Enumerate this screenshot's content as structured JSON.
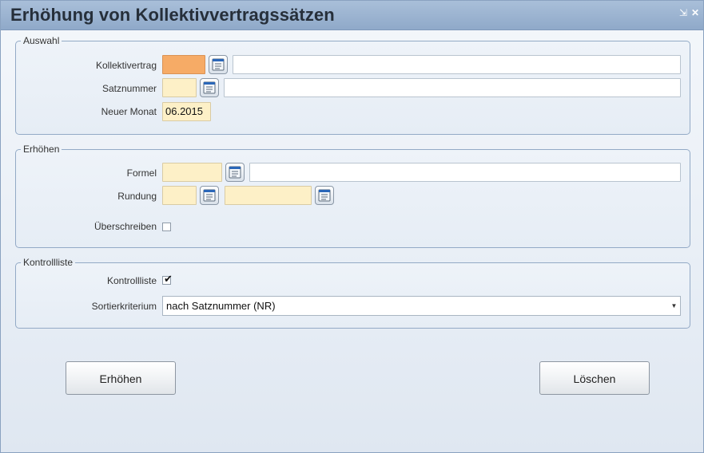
{
  "window": {
    "title": "Erhöhung von Kollektivvertragssätzen",
    "restore_glyph": "⇲",
    "close_glyph": "✕"
  },
  "auswahl": {
    "legend": "Auswahl",
    "kollektivvertrag_label": "Kollektivertrag",
    "kollektivvertrag_code": "",
    "kollektivvertrag_text": "",
    "satznummer_label": "Satznummer",
    "satznummer_code": "",
    "satznummer_text": "",
    "neuer_monat_label": "Neuer Monat",
    "neuer_monat_value": "06.2015"
  },
  "erhoehen": {
    "legend": "Erhöhen",
    "formel_label": "Formel",
    "formel_code": "",
    "formel_text": "",
    "rundung_label": "Rundung",
    "rundung_code": "",
    "rundung_text": "",
    "ueberschreiben_label": "Überschreiben",
    "ueberschreiben_checked": false
  },
  "kontrollliste": {
    "legend": "Kontrollliste",
    "kontrollliste_label": "Kontrollliste",
    "kontrollliste_checked": true,
    "check_glyph": "✔",
    "sortierkriterium_label": "Sortierkriterium",
    "sortierkriterium_value": "nach Satznummer (NR)"
  },
  "buttons": {
    "erhoehen": "Erhöhen",
    "loeschen": "Löschen"
  },
  "icons": {
    "picker": "list-picker-icon",
    "dropdown": "chevron-down-icon"
  }
}
